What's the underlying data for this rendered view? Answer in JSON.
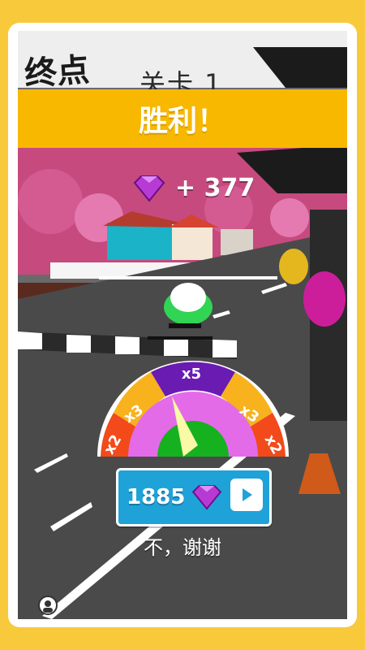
{
  "hud": {
    "finish_label": "终点",
    "level_label": "关卡 1",
    "banner_title": "胜利！"
  },
  "reward": {
    "text": "+ 377",
    "gem_icon": "gem-icon"
  },
  "multiplier": {
    "segments": [
      "x2",
      "x3",
      "x5",
      "x3",
      "x2"
    ],
    "colors": {
      "x2": "#f24a1a",
      "x3": "#f7b21d",
      "x5": "#6a1bb1",
      "inner": "#e36be8",
      "center": "#16b11e"
    },
    "pointer_color": "#f9f9a7"
  },
  "claim_button": {
    "amount": "1885",
    "gem_icon": "gem-icon",
    "play_icon": "play-icon"
  },
  "no_thanks": {
    "label": "不，谢谢"
  },
  "misc": {
    "profile_icon": "profile-icon"
  }
}
